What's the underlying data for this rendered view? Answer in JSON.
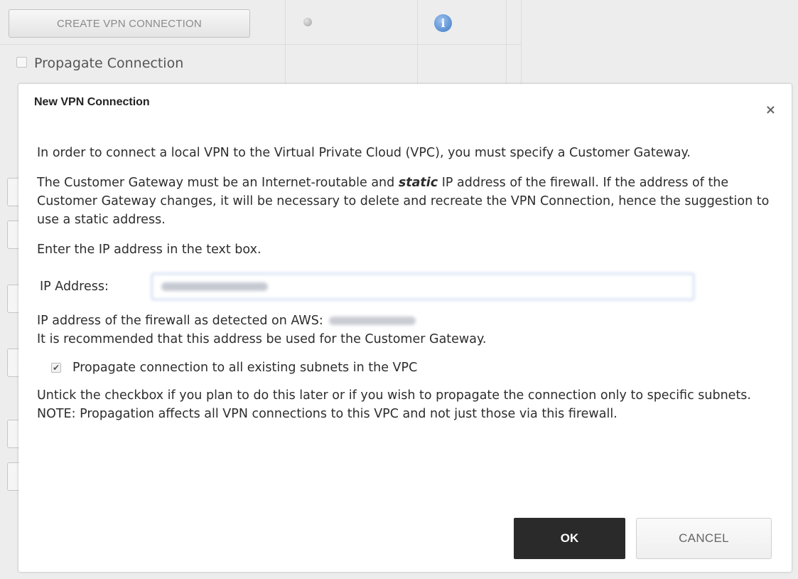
{
  "background": {
    "create_vpn_button": "CREATE VPN CONNECTION",
    "propagate_label": "Propagate Connection",
    "info_icon": "i"
  },
  "dialog": {
    "title": "New VPN Connection",
    "close_icon": "×",
    "intro": "In order to connect a local VPN to the Virtual Private Cloud (VPC), you must specify a Customer Gateway.",
    "gateway_pre": "The Customer Gateway must be an Internet-routable and ",
    "gateway_emph": "static",
    "gateway_post": " IP address of the firewall. If the address of the Customer Gateway changes, it will be necessary to delete and recreate the VPN Connection, hence the suggestion to use a static address.",
    "enter_ip": "Enter the IP address in the text box.",
    "ip_label": "IP Address:",
    "ip_value": "",
    "detected_label": "IP address of the firewall as detected on AWS:",
    "recommend": "It is recommended that this address be used for the Customer Gateway.",
    "propagate_checked": true,
    "propagate_label": "Propagate connection to all existing subnets in the VPC",
    "untick_note": "Untick the checkbox if you plan to do this later or if you wish to propagate the connection only to specific subnets.",
    "propagation_note": "NOTE: Propagation affects all VPN connections to this VPC and not just those via this firewall.",
    "ok_label": "OK",
    "cancel_label": "CANCEL"
  },
  "colors": {
    "ok_bg": "#2a2a2a",
    "input_border": "#9fb7e3",
    "info_icon": "#3d79c7"
  }
}
